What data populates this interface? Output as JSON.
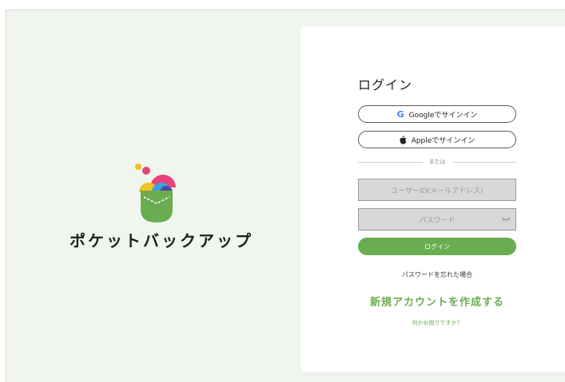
{
  "brand": {
    "name": "ポケットバックアップ"
  },
  "login": {
    "title": "ログイン",
    "google_button": "Googleでサインイン",
    "apple_button": "Appleでサインイン",
    "divider_text": "または",
    "user_id_placeholder": "ユーザーID(メールアドレス)",
    "password_placeholder": "パスワード",
    "submit_label": "ログイン",
    "forgot_password": "パスワードを忘れた場合",
    "create_account": "新規アカウントを作成する",
    "help": "何かお困りですか？"
  },
  "icons": {
    "google": "google-icon",
    "apple": "apple-icon",
    "password_toggle": "eye-closed-icon"
  },
  "colors": {
    "accent": "#6aad51",
    "background": "#f1f5ef",
    "field_bg": "#d8d8d8"
  }
}
